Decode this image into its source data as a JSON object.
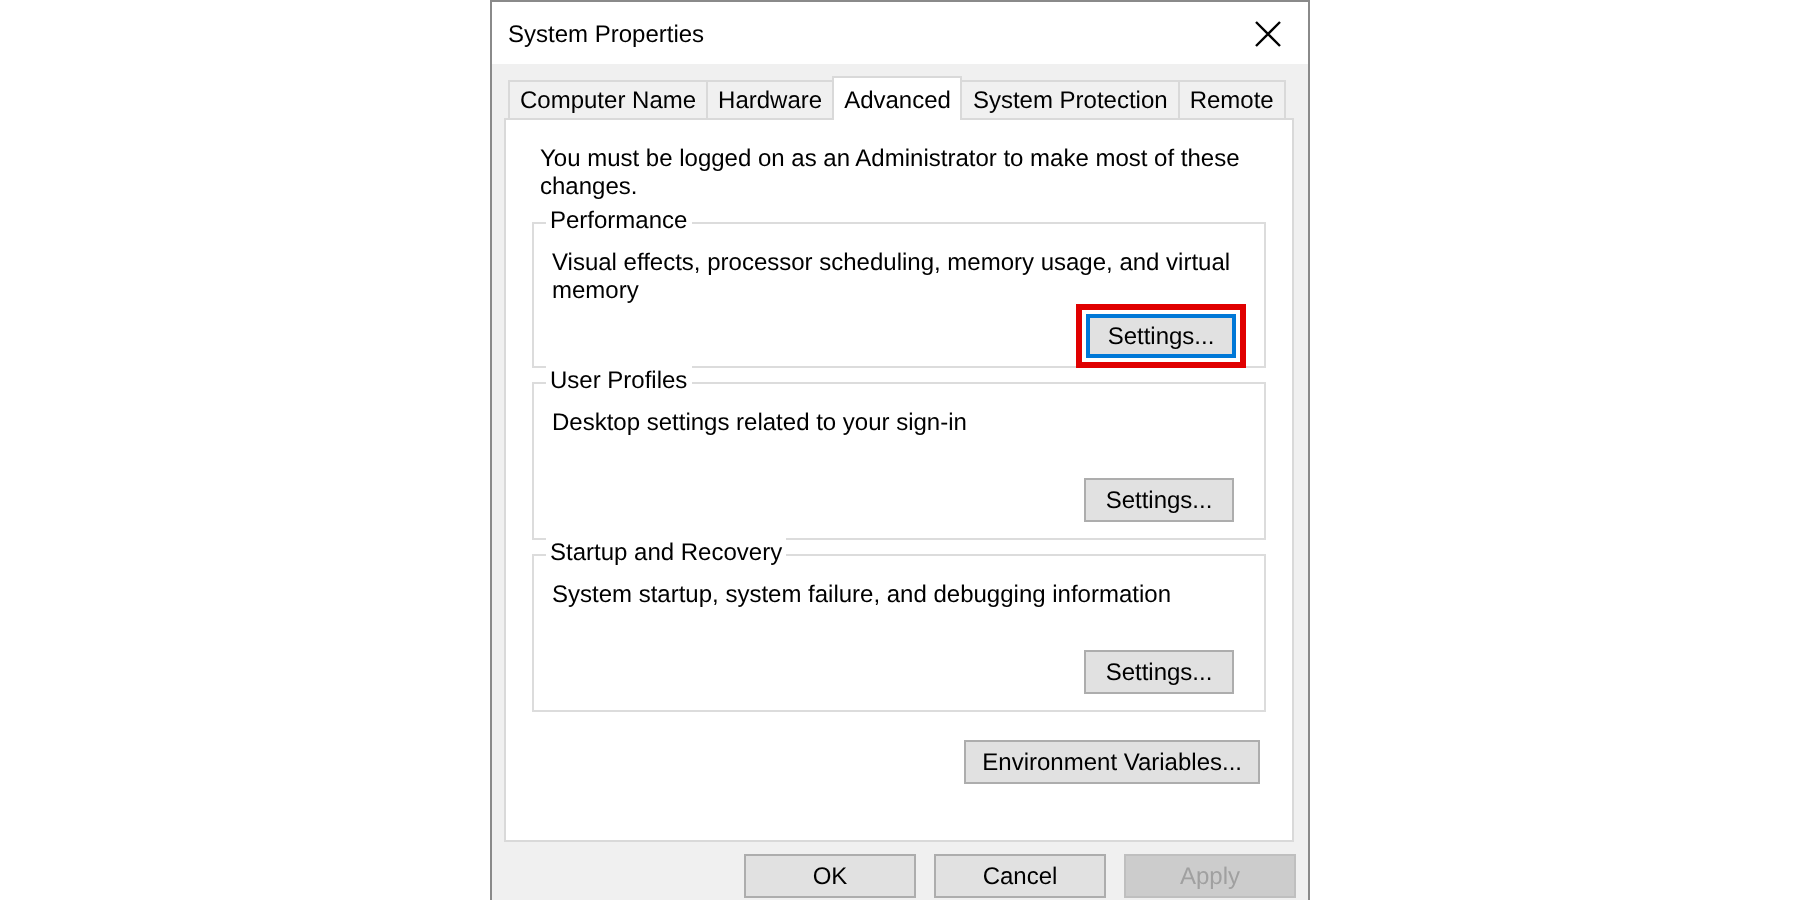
{
  "window": {
    "title": "System Properties"
  },
  "tabs": [
    {
      "label": "Computer Name",
      "selected": false
    },
    {
      "label": "Hardware",
      "selected": false
    },
    {
      "label": "Advanced",
      "selected": true
    },
    {
      "label": "System Protection",
      "selected": false
    },
    {
      "label": "Remote",
      "selected": false
    }
  ],
  "notice": "You must be logged on as an Administrator to make most of these changes.",
  "groups": [
    {
      "title": "Performance",
      "description": "Visual effects, processor scheduling, memory usage, and virtual memory",
      "button": "Settings...",
      "focused": true,
      "highlighted": true
    },
    {
      "title": "User Profiles",
      "description": "Desktop settings related to your sign-in",
      "button": "Settings...",
      "focused": false,
      "highlighted": false
    },
    {
      "title": "Startup and Recovery",
      "description": "System startup, system failure, and debugging information",
      "button": "Settings...",
      "focused": false,
      "highlighted": false
    }
  ],
  "environment_button": "Environment Variables...",
  "buttons": [
    {
      "label": "OK",
      "disabled": false
    },
    {
      "label": "Cancel",
      "disabled": false
    },
    {
      "label": "Apply",
      "disabled": true
    }
  ]
}
